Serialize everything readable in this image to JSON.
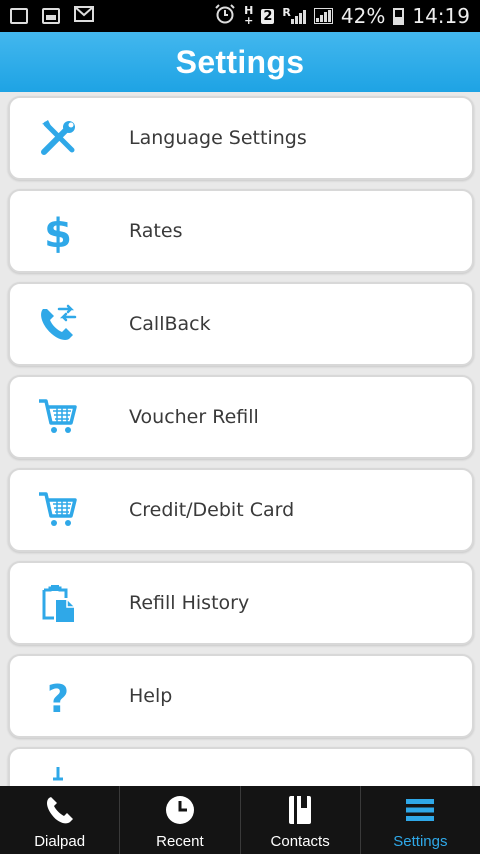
{
  "status_bar": {
    "network_top": "H",
    "network_bottom": "+",
    "sim": "2",
    "roaming": "R",
    "battery": "42%",
    "time": "14:19"
  },
  "header": {
    "title": "Settings"
  },
  "colors": {
    "accent": "#2fa8e8",
    "header_top": "#43b7ee",
    "header_bottom": "#1ea3e4",
    "text": "#3a3a3a"
  },
  "settings": {
    "items": [
      {
        "label": "Language Settings",
        "icon": "tools-icon"
      },
      {
        "label": "Rates",
        "icon": "dollar-icon"
      },
      {
        "label": "CallBack",
        "icon": "callback-phone-icon"
      },
      {
        "label": "Voucher Refill",
        "icon": "cart-icon"
      },
      {
        "label": "Credit/Debit Card",
        "icon": "cart-icon"
      },
      {
        "label": "Refill History",
        "icon": "clipboard-icon"
      },
      {
        "label": "Help",
        "icon": "question-icon"
      },
      {
        "label": "",
        "icon": "partial-icon"
      }
    ]
  },
  "nav": {
    "tabs": [
      {
        "label": "Dialpad",
        "icon": "phone-icon"
      },
      {
        "label": "Recent",
        "icon": "clock-icon"
      },
      {
        "label": "Contacts",
        "icon": "contacts-book-icon"
      },
      {
        "label": "Settings",
        "icon": "menu-icon",
        "active": true
      }
    ]
  }
}
